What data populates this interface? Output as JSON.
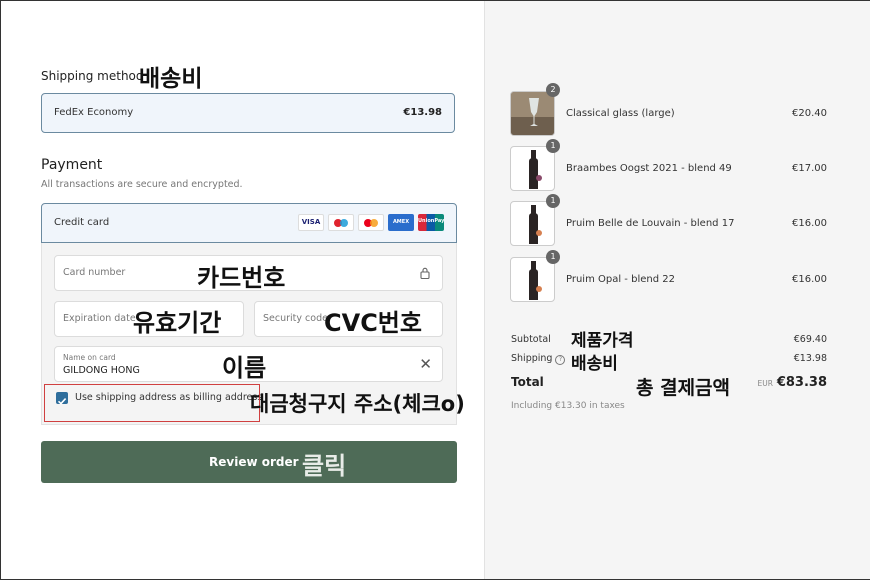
{
  "shipping": {
    "title": "Shipping method",
    "note": "배송비",
    "option_label": "FedEx Economy",
    "option_price": "€13.98"
  },
  "payment": {
    "title": "Payment",
    "subtitle": "All transactions are secure and encrypted.",
    "method_label": "Credit card",
    "card_brands": [
      "VISA",
      "maestro",
      "mastercard",
      "AMEX",
      "UnionPay"
    ],
    "card_number_placeholder": "Card number",
    "card_number_note": "카드번호",
    "expiration_placeholder": "Expiration date",
    "expiration_note": "유효기간",
    "security_placeholder": "Security code",
    "security_note": "CVC번호",
    "name_label": "Name on card",
    "name_value": "GILDONG HONG",
    "name_note": "이름",
    "billing_checkbox_label": "Use shipping address as billing address",
    "billing_checked": true,
    "billing_note": "대금청구지 주소(체크o)",
    "review_button": "Review order",
    "review_note": "클릭"
  },
  "cart": {
    "items": [
      {
        "qty": "2",
        "name": "Classical glass (large)",
        "price": "€20.40",
        "icon": "glass-icon"
      },
      {
        "qty": "1",
        "name": "Braambes Oogst 2021 - blend 49",
        "price": "€17.00",
        "icon": "bottle-icon"
      },
      {
        "qty": "1",
        "name": "Pruim Belle de Louvain - blend 17",
        "price": "€16.00",
        "icon": "bottle-icon"
      },
      {
        "qty": "1",
        "name": "Pruim Opal - blend 22",
        "price": "€16.00",
        "icon": "bottle-icon"
      }
    ],
    "subtotal_label": "Subtotal",
    "subtotal_value": "€69.40",
    "subtotal_note": "제품가격",
    "shipping_label": "Shipping",
    "shipping_value": "€13.98",
    "shipping_note": "배송비",
    "total_label": "Total",
    "total_currency": "EUR",
    "total_value": "€83.38",
    "total_note": "총 결제금액",
    "taxes": "Including €13.30 in taxes"
  },
  "colors": {
    "accent_button": "#4e6b57",
    "selected_border": "#6b8aa0",
    "annotation_red": "#d04040"
  }
}
